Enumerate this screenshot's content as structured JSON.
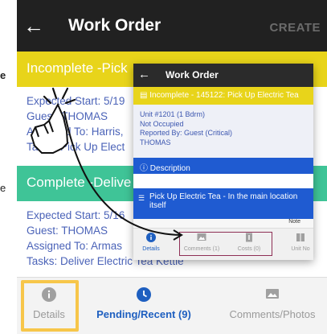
{
  "outer": {
    "back_glyph": "←",
    "title": "Work Order",
    "create_label": "CREATE",
    "left_peek_1": "e",
    "left_peek_2": "e",
    "banner1": "Incomplete -Pick",
    "card1": {
      "line1": "Expected Start: 5/19",
      "line2": "Guest: THOMAS",
      "line3": "Assigned To: Harris, ",
      "line4": "Tasks: Pick Up Elect"
    },
    "banner2": "Complete -Delive",
    "card2": {
      "line1": "Expected Start: 5/16",
      "line2": "Guest: THOMAS",
      "line3": "Assigned To: Armas",
      "line4": "Tasks: Deliver Electric Tea Kettle"
    },
    "nav": {
      "details": "Details",
      "pending": "Pending/Recent (9)",
      "comments": "Comments/Photos"
    }
  },
  "inner": {
    "back_glyph": "←",
    "title": "Work Order",
    "banner": "Incomplete - 145122: Pick Up Electric Tea",
    "unit": "Unit #1201 (1 Bdrm)",
    "occupancy": "Not Occupied",
    "reported": "Reported By: Guest  (Critical)",
    "reporter": "THOMAS",
    "description_label": "Description",
    "task": "Pick Up Electric Tea  - In the main location itself",
    "note_label": "Note",
    "nav": {
      "details": "Details",
      "comments": "Comments (1)",
      "costs": "Costs (0)",
      "unit": "Unit No"
    }
  },
  "colors": {
    "incomplete": "#e8d41a",
    "complete": "#3fc497",
    "accent_blue": "#1f5bd1",
    "highlight": "#f7c64a",
    "appbar": "#212121"
  }
}
